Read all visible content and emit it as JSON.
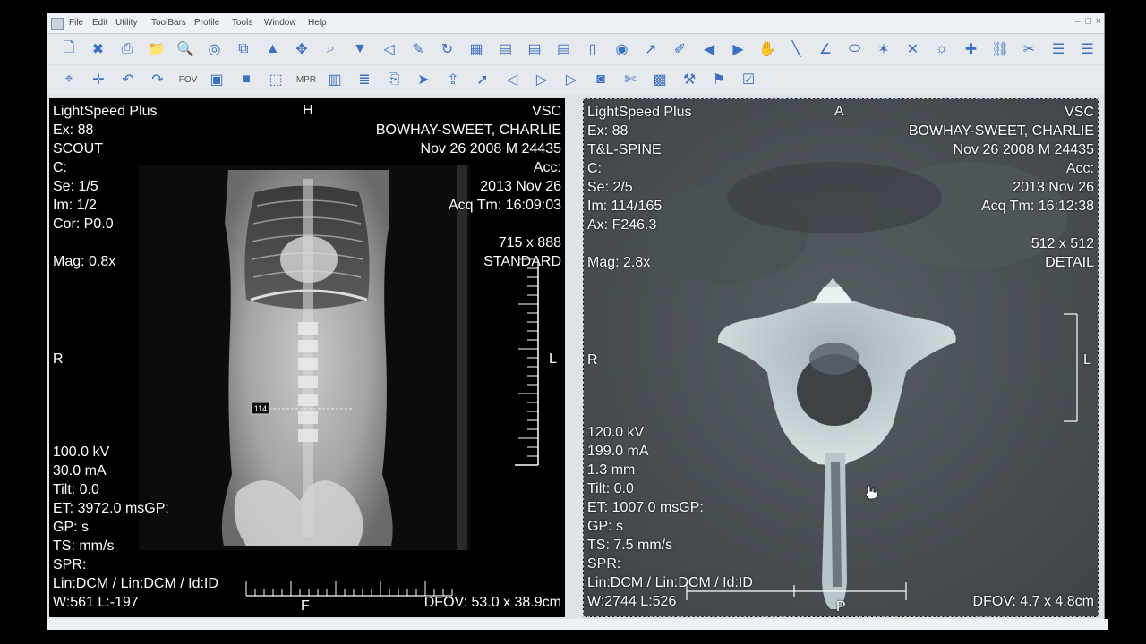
{
  "menu": {
    "items": [
      "File",
      "Edit",
      "Utility",
      "ToolBars",
      "Profile",
      "Tools",
      "Window",
      "Help"
    ]
  },
  "toolbar": {
    "row1_icons": [
      "new-page-icon",
      "close-doc-icon",
      "print-icon",
      "folder-icon",
      "print-preview-icon",
      "cd-icon",
      "layers-icon",
      "arrow-up-icon",
      "move-icon",
      "zoom-icon",
      "arrow-down-icon",
      "arrow-left-icon",
      "edit-icon",
      "rotate-icon",
      "grid-icon",
      "grid-text-icon",
      "grid-text-icon",
      "grid-text-icon",
      "document-icon",
      "eye-icon",
      "arrow-icon",
      "pen-icon",
      "play-left-icon",
      "play-right-icon",
      "pan-icon",
      "line-icon",
      "angle-icon",
      "ellipse-icon",
      "magic-icon",
      "cross-icon",
      "sun-icon",
      "pin-icon",
      "chain-icon",
      "scissors-icon",
      "align-icon",
      "align-icon"
    ],
    "row2_icons": [
      "crosshair-icon",
      "cross-arrows-icon",
      "undo-icon",
      "redo-icon",
      "fov-icon",
      "image-icon",
      "stop-icon",
      "select-icon",
      "mpr-icon",
      "bars-icon",
      "stack-icon",
      "copy-icon",
      "send-icon",
      "export-icon",
      "pointer-icon",
      "arrow-left-icon",
      "arrow-right-icon",
      "arrow-right-icon",
      "camera-icon",
      "cut-icon",
      "film-icon",
      "tools-icon",
      "flag-icon",
      "check-icon"
    ],
    "fov_label": "FOV",
    "mpr_label": "MPR"
  },
  "left_viewport": {
    "top_left": [
      "LightSpeed Plus",
      "Ex: 88",
      "SCOUT",
      "C:",
      "Se: 1/5",
      "Im: 1/2",
      "Cor: P0.0",
      "",
      "Mag: 0.8x"
    ],
    "top_right": [
      "VSC",
      "BOWHAY-SWEET, CHARLIE",
      "Nov 26 2008 M 24435",
      "Acc:",
      "2013 Nov 26",
      "Acq Tm: 16:09:03",
      "",
      "715 x 888",
      "STANDARD"
    ],
    "bottom_left": [
      "100.0 kV",
      "30.0 mA",
      "Tilt: 0.0",
      "ET: 3972.0 msGP:",
      "GP:  s",
      "TS:  mm/s",
      "SPR:",
      "Lin:DCM / Lin:DCM / Id:ID",
      "W:561  L:-197"
    ],
    "bottom_right": [
      "DFOV: 53.0 x 38.9cm"
    ],
    "orient_top": "H",
    "orient_left": "R",
    "orient_right": "L",
    "orient_bottom": "F",
    "slice_marker": "114"
  },
  "right_viewport": {
    "top_left": [
      "LightSpeed Plus",
      "Ex: 88",
      "T&L-SPINE",
      "C:",
      "Se: 2/5",
      "Im: 114/165",
      "Ax: F246.3",
      "",
      "Mag: 2.8x"
    ],
    "top_right": [
      "VSC",
      "BOWHAY-SWEET, CHARLIE",
      "Nov 26 2008 M 24435",
      "Acc:",
      "2013 Nov 26",
      "Acq Tm: 16:12:38",
      "",
      "512 x 512",
      "DETAIL"
    ],
    "bottom_left": [
      "120.0 kV",
      "199.0 mA",
      "1.3 mm",
      "Tilt: 0.0",
      "ET: 1007.0 msGP:",
      "GP:  s",
      "TS: 7.5 mm/s",
      "SPR:",
      "Lin:DCM / Lin:DCM / Id:ID",
      "W:2744  L:526"
    ],
    "bottom_right": [
      "DFOV: 4.7 x 4.8cm"
    ],
    "orient_top": "A",
    "orient_left": "R",
    "orient_right": "L",
    "orient_bottom": "P"
  },
  "colors": {
    "toolbar_icon": "#3a70c0",
    "window_bg": "#dfe3e8",
    "overlay_text": "#ffffff",
    "ct_background": "#4a5156"
  }
}
